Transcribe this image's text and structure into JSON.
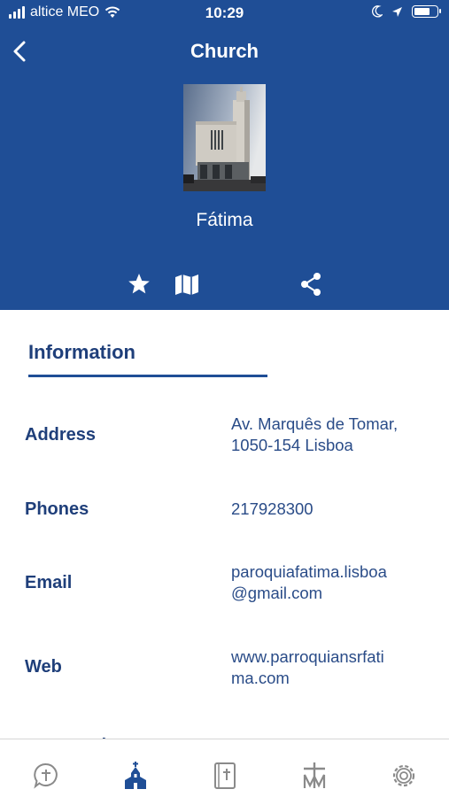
{
  "status_bar": {
    "carrier": "altice MEO",
    "time": "10:29",
    "battery_level": 0.75
  },
  "nav": {
    "title": "Church",
    "back_icon": "chevron-left-icon"
  },
  "church": {
    "name": "Fátima",
    "photo": "church-building-photo"
  },
  "actions": [
    {
      "name": "favorite",
      "icon": "star-icon"
    },
    {
      "name": "map",
      "icon": "map-icon"
    },
    {
      "name": "share",
      "icon": "share-icon"
    }
  ],
  "tabs": {
    "information": "Information"
  },
  "info": {
    "address_label": "Address",
    "address_line1": "Av. Marquês de Tomar,",
    "address_line2": "1050-154 Lisboa",
    "phones_label": "Phones",
    "phones_value": "217928300",
    "email_label": "Email",
    "email_line1": "paroquiafatima.lisboa",
    "email_line2": "@gmail.com",
    "web_label": "Web",
    "web_line1": "www.parroquiansrfati",
    "web_line2": "ma.com",
    "next_label": "Community"
  },
  "tabbar": {
    "items": [
      {
        "icon": "prayer-bubble-icon",
        "active": false
      },
      {
        "icon": "church-icon",
        "active": true
      },
      {
        "icon": "bible-icon",
        "active": false
      },
      {
        "icon": "cross-monogram-icon",
        "active": false
      },
      {
        "icon": "settings-gear-icon",
        "active": false
      }
    ]
  },
  "colors": {
    "primary": "#1f4e96",
    "text_dark_blue": "#1f3f7a",
    "inactive_icon": "#8a8a8a"
  }
}
